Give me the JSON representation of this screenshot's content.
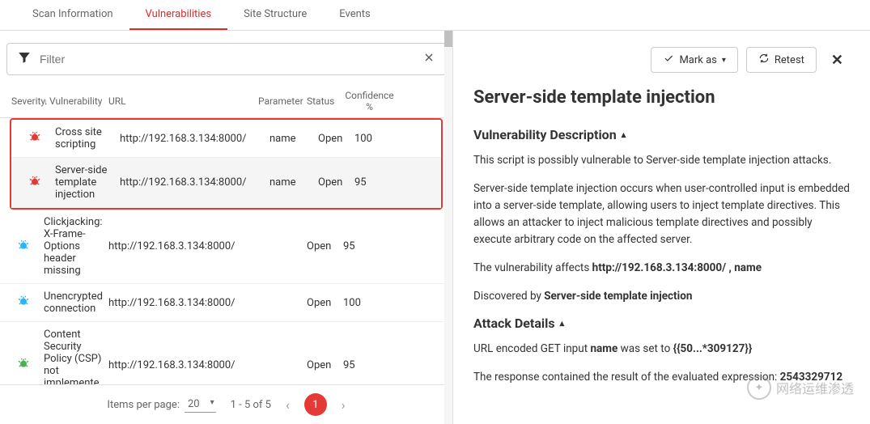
{
  "tabs": {
    "t0": "Scan Information",
    "t1": "Vulnerabilities",
    "t2": "Site Structure",
    "t3": "Events"
  },
  "filter": {
    "placeholder": "Filter"
  },
  "cols": {
    "sev": "Severity",
    "vuln": "Vulnerability",
    "url": "URL",
    "param": "Parameter",
    "status": "Status",
    "conf": "Confidence %"
  },
  "rows": [
    {
      "sev": "high",
      "vuln": "Cross site scripting",
      "url": "http://192.168.3.134:8000/",
      "param": "name",
      "status": "Open",
      "conf": "100"
    },
    {
      "sev": "high",
      "vuln": "Server-side template injection",
      "url": "http://192.168.3.134:8000/",
      "param": "name",
      "status": "Open",
      "conf": "95"
    },
    {
      "sev": "info",
      "vuln": "Clickjacking: X-Frame-Options header missing",
      "url": "http://192.168.3.134:8000/",
      "param": "",
      "status": "Open",
      "conf": "95"
    },
    {
      "sev": "info",
      "vuln": "Unencrypted connection",
      "url": "http://192.168.3.134:8000/",
      "param": "",
      "status": "Open",
      "conf": "100"
    },
    {
      "sev": "ok",
      "vuln": "Content Security Policy (CSP) not implemented",
      "url": "http://192.168.3.134:8000/",
      "param": "",
      "status": "Open",
      "conf": "95"
    }
  ],
  "pager": {
    "ipp": "Items per page:",
    "ipp_val": "20",
    "range": "1 - 5 of 5",
    "cur": "1"
  },
  "actions": {
    "markas": "Mark as",
    "retest": "Retest"
  },
  "detail": {
    "title": "Server-side template injection",
    "sec1": "Vulnerability Description",
    "p1": "This script is possibly vulnerable to Server-side template injection attacks.",
    "p2": "Server-side template injection occurs when user-controlled input is embedded into a server-side template, allowing users to inject template directives. This allows an attacker to inject malicious template directives and possibly execute arbitrary code on the affected server.",
    "p3a": "The vulnerability affects ",
    "p3b": "http://192.168.3.134:8000/ , name",
    "p4a": "Discovered by ",
    "p4b": "Server-side template injection",
    "sec2": "Attack Details",
    "p5a": "URL encoded GET input ",
    "p5b": "name",
    "p5c": " was set to ",
    "p5d": "{{50...*309127}}",
    "p6a": "The response contained the result of the evaluated expression: ",
    "p6b": "2543329712"
  },
  "wm": "网络运维渗透"
}
